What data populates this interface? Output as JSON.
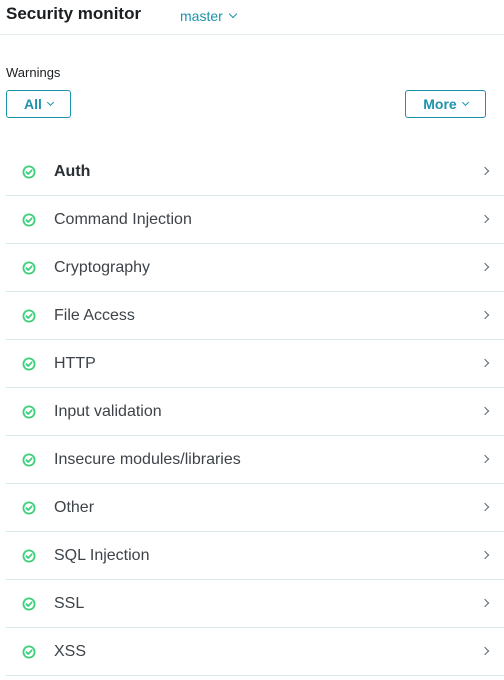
{
  "header": {
    "title": "Security monitor",
    "branch": "master"
  },
  "filters": {
    "label": "Warnings",
    "all_label": "All",
    "more_label": "More"
  },
  "categories": [
    {
      "label": "Auth",
      "status": "ok",
      "active": true
    },
    {
      "label": "Command Injection",
      "status": "ok"
    },
    {
      "label": "Cryptography",
      "status": "ok"
    },
    {
      "label": "File Access",
      "status": "ok"
    },
    {
      "label": "HTTP",
      "status": "ok"
    },
    {
      "label": "Input validation",
      "status": "ok"
    },
    {
      "label": "Insecure modules/libraries",
      "status": "ok"
    },
    {
      "label": "Other",
      "status": "ok"
    },
    {
      "label": "SQL Injection",
      "status": "ok"
    },
    {
      "label": "SSL",
      "status": "ok"
    },
    {
      "label": "XSS",
      "status": "ok"
    }
  ],
  "colors": {
    "accent": "#1d93ad",
    "ok": "#3dd07a",
    "divider": "#d8e8ea"
  },
  "icons": {
    "status": "check-circle-icon",
    "row_action": "chevron-right-icon",
    "dropdown": "chevron-down-icon"
  }
}
